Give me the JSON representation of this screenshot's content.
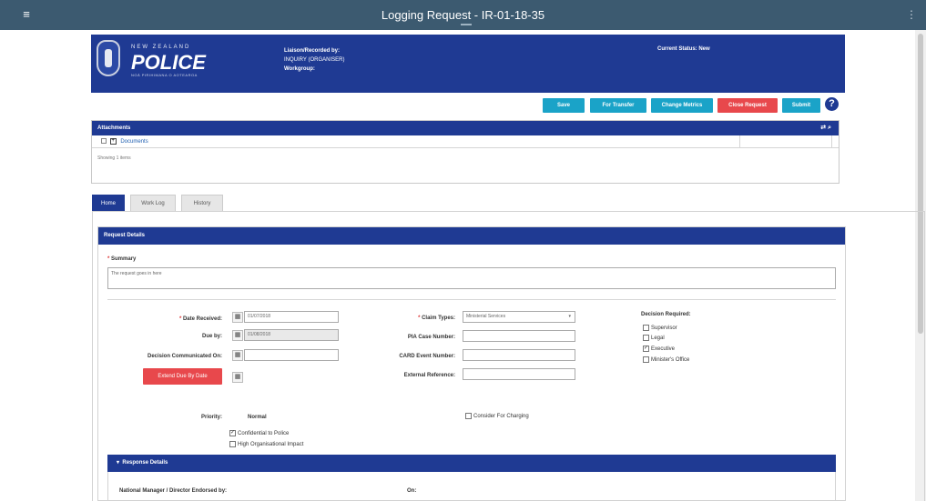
{
  "app": {
    "title": "Logging Request - IR-01-18-35"
  },
  "banner": {
    "logo_nz": "NEW ZEALAND",
    "logo_police": "POLICE",
    "logo_tag": "NGĀ PIRIHIMANA O AOTEAROA",
    "liaison_label": "Liaison/Recorded by:",
    "liaison_value": "INQUIRY (ORGANISER)",
    "workgroup_label": "Workgroup:",
    "status_label": "Current Status:",
    "status_value": "New"
  },
  "toolbar": {
    "save": "Save",
    "for_transfer": "For Transfer",
    "change_metrics": "Change Metrics",
    "close_request": "Close Request",
    "submit": "Submit",
    "help": "?"
  },
  "attachments": {
    "title": "Attachments",
    "icons": "⇄ ⌕",
    "folder": "Documents",
    "footer": "Showing 1 items"
  },
  "tabs": {
    "items": [
      "Home",
      "Work Log",
      "History"
    ]
  },
  "request": {
    "title": "Request Details",
    "summary_label": "Summary",
    "summary_value": "The request goes in here",
    "date_received_label": "Date Received:",
    "date_received_value": "01/07/2018",
    "due_by_label": "Due by:",
    "due_by_value": "01/08/2018",
    "decision_comm_label": "Decision Communicated On:",
    "extend_button": "Extend Due By Date",
    "claim_types_label": "Claim Types:",
    "claim_types_value": "Ministerial Services",
    "pia_label": "PIA Case Number:",
    "cars_label": "CARD Event Number:",
    "external_label": "External Reference:",
    "decision_required_label": "Decision Required:",
    "decisions": [
      "Supervisor",
      "Legal",
      "Executive",
      "Minister's Office"
    ],
    "priority_label": "Priority:",
    "priority_value": "Normal",
    "confidential_label": "Confidential to Police",
    "high_org_label": "High Organisational Impact",
    "consider_label": "Consider For Charging"
  },
  "response": {
    "title": "Response Details",
    "manager_label": "National Manager / Director Endorsed by:",
    "on_label": "On:"
  },
  "colors": {
    "navy": "#1f3a93",
    "teal": "#1aa3c8",
    "red": "#e8484c",
    "topbar": "#3c5a70"
  }
}
